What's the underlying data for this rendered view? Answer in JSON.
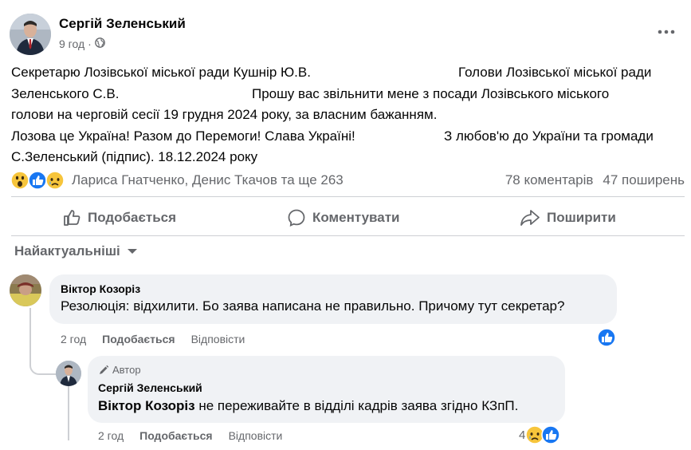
{
  "post": {
    "author": "Сергій Зеленський",
    "time": "9 год",
    "separator": "·",
    "audience_icon": "globe-icon",
    "lines": [
      {
        "a": "Секретарю Лозівської міської ради Кушнір Ю.В.",
        "b": "Голови Лозівської міської ради"
      },
      {
        "a": "Зеленського С.В.",
        "b": "Прошу вас звільнити мене з посади Лозівського міського"
      },
      {
        "a": "голови на черговій сесії 19 грудня 2024 року, за власним бажанням.",
        "b": ""
      },
      {
        "a": "Лозова це Україна! Разом до Перемоги! Слава Україні!",
        "b": "З любов'ю до України та громади"
      },
      {
        "a": "С.Зеленський (підпис).   18.12.2024 року",
        "b": ""
      }
    ],
    "reactions": {
      "icons": [
        "wow-icon",
        "like-icon",
        "sad-icon"
      ],
      "names": "Лариса Гнатченко, Денис Ткачов та ще 263",
      "comments_count": "78 коментарів",
      "shares_count": "47 поширень"
    },
    "actions": {
      "like": "Подобається",
      "comment": "Коментувати",
      "share": "Поширити"
    }
  },
  "sort": {
    "label": "Найактуальніші"
  },
  "comments": [
    {
      "author": "Віктор Козоріз",
      "text": "Резолюція: відхилити. Бо заява написана не правильно. Причому тут секретар?",
      "time": "2 год",
      "like": "Подобається",
      "reply": "Відповісти",
      "reaction_icons": [
        "like-icon"
      ]
    }
  ],
  "reply": {
    "badge": "Автор",
    "author": "Сергій Зеленський",
    "mention": "Віктор Козоріз",
    "text": " не переживайте в відділі кадрів заява згідно КЗпП.",
    "time": "2 год",
    "like": "Подобається",
    "reply": "Відповісти",
    "reaction_count": "4",
    "reaction_icons": [
      "sad-icon",
      "like-icon"
    ]
  },
  "colors": {
    "like_blue": "#1877f2",
    "secondary_text": "#65676b",
    "bubble_bg": "#f0f2f5"
  }
}
